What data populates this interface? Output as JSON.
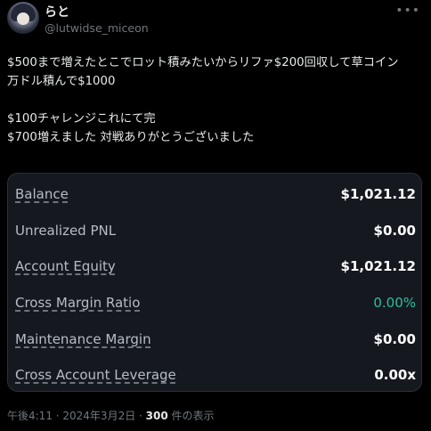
{
  "author": {
    "display_name": "らと",
    "handle": "@lutwidse_miceon"
  },
  "more_icon": "more-horizontal-icon",
  "tweet": {
    "lines": [
      "$500まで増えたとこでロット積みたいからリファ$200回収して草コイン",
      "万ドル積んで$1000",
      "",
      "$100チャレンジこれにて完",
      "$700増えました 対戦ありがとうございました"
    ]
  },
  "account_card": {
    "rows": [
      {
        "label": "Balance",
        "value": "$1,021.12"
      },
      {
        "label": "Unrealized PNL",
        "value": "$0.00"
      },
      {
        "label": "Account Equity",
        "value": "$1,021.12"
      },
      {
        "label": "Cross Margin Ratio",
        "value": "0.00%"
      },
      {
        "label": "Maintenance Margin",
        "value": "$0.00"
      },
      {
        "label": "Cross Account Leverage",
        "value": "0.00x"
      }
    ],
    "accent_color": "#2ebd9f"
  },
  "footer": {
    "timestamp": "午後4:11 · 2024年3月2日 · ",
    "views_count": "300",
    "views_label": " 件の表示"
  }
}
